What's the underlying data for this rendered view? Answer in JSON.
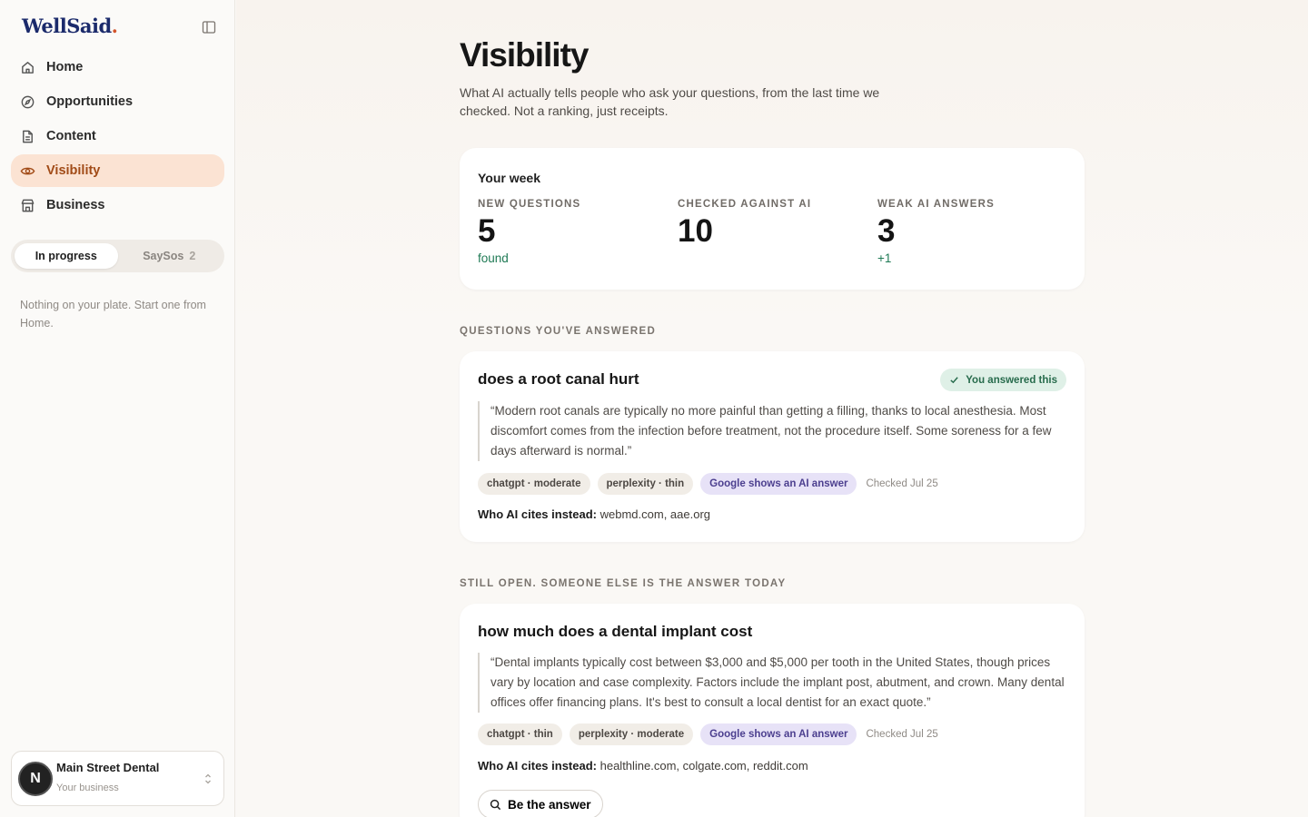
{
  "brand": {
    "name": "WellSaid",
    "dot": "."
  },
  "sidebar": {
    "items": [
      {
        "label": "Home",
        "icon": "home-icon"
      },
      {
        "label": "Opportunities",
        "icon": "compass-icon"
      },
      {
        "label": "Content",
        "icon": "document-icon"
      },
      {
        "label": "Visibility",
        "icon": "eye-icon",
        "active": true
      },
      {
        "label": "Business",
        "icon": "store-icon"
      }
    ],
    "toggle": {
      "in_progress": "In progress",
      "saysos": "SaySos",
      "saysos_count": "2"
    },
    "empty_note": "Nothing on your plate. Start one from Home.",
    "business": {
      "avatar_letter": "N",
      "name": "Main Street Dental",
      "subtitle": "Your business"
    }
  },
  "main": {
    "title": "Visibility",
    "subtitle": "What AI actually tells people who ask your questions, from the last time we checked. Not a ranking, just receipts.",
    "week": {
      "title": "Your week",
      "stats": [
        {
          "label": "NEW QUESTIONS",
          "value": "5",
          "delta": "found"
        },
        {
          "label": "CHECKED AGAINST AI",
          "value": "10",
          "delta": ""
        },
        {
          "label": "WEAK AI ANSWERS",
          "value": "3",
          "delta": "+1"
        }
      ]
    },
    "answered_section": "QUESTIONS YOU'VE ANSWERED",
    "answered": {
      "question": "does a root canal hurt",
      "badge": "You answered this",
      "quote": "“Modern root canals are typically no more painful than getting a filling, thanks to local anesthesia. Most discomfort comes from the infection before treatment, not the procedure itself. Some soreness for a few days afterward is normal.”",
      "tags": [
        "chatgpt · moderate",
        "perplexity · thin",
        "Google shows an AI answer"
      ],
      "checked": "Checked Jul 25",
      "cites_label": "Who AI cites instead:",
      "cites": "webmd.com, aae.org"
    },
    "open_section": "STILL OPEN. SOMEONE ELSE IS THE ANSWER TODAY",
    "open": {
      "question": "how much does a dental implant cost",
      "quote": "“Dental implants typically cost between $3,000 and $5,000 per tooth in the United States, though prices vary by location and case complexity. Factors include the implant post, abutment, and crown. Many dental offices offer financing plans. It's best to consult a local dentist for an exact quote.”",
      "tags": [
        "chatgpt · thin",
        "perplexity · moderate",
        "Google shows an AI answer"
      ],
      "checked": "Checked Jul 25",
      "cites_label": "Who AI cites instead:",
      "cites": "healthline.com, colgate.com, reddit.com",
      "action": "Be the answer"
    }
  },
  "colors": {
    "accent": "#a14b17",
    "active_bg": "#fbe3d3",
    "brand": "#1b2a6b",
    "positive": "#1f7a55"
  }
}
